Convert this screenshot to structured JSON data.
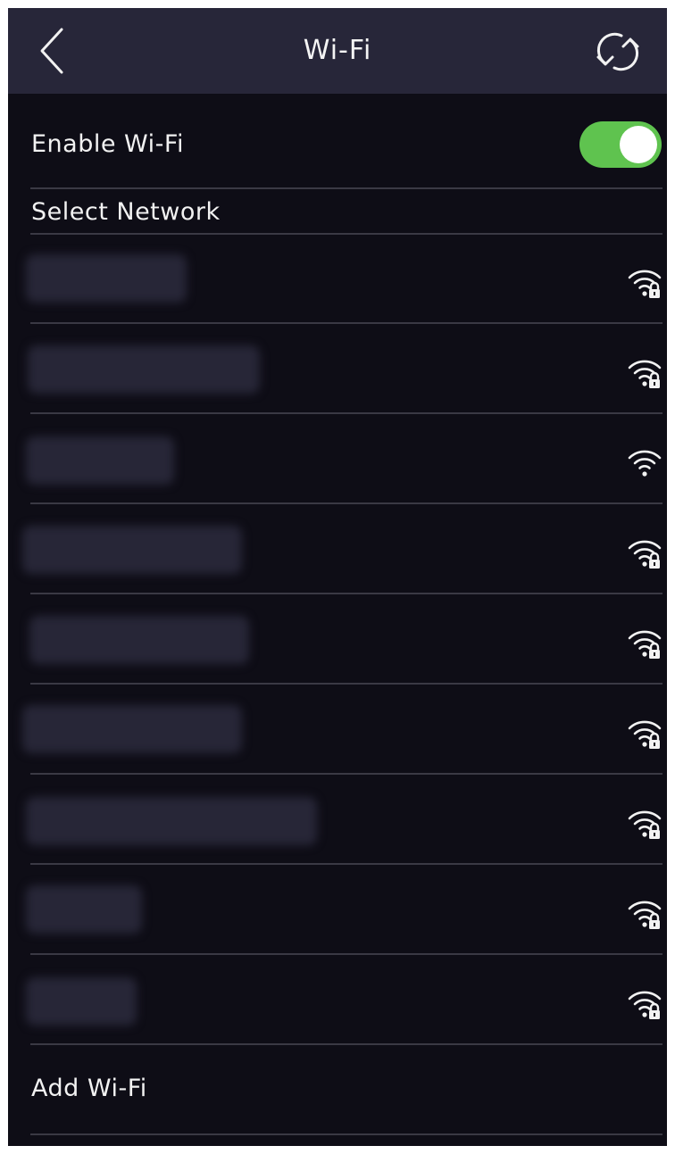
{
  "header": {
    "title": "Wi-Fi",
    "back_icon": "chevron-left-icon",
    "refresh_icon": "refresh-icon"
  },
  "enable_wifi": {
    "label": "Enable Wi-Fi",
    "enabled": true,
    "toggle_color": "#5fc34f"
  },
  "select_network": {
    "label": "Select Network"
  },
  "networks": [
    {
      "name": "",
      "obscured": true,
      "secured": true,
      "icon": "wifi-lock-icon"
    },
    {
      "name": "",
      "obscured": true,
      "secured": true,
      "icon": "wifi-lock-icon"
    },
    {
      "name": "",
      "obscured": true,
      "secured": false,
      "icon": "wifi-icon"
    },
    {
      "name": "",
      "obscured": true,
      "secured": true,
      "icon": "wifi-lock-icon"
    },
    {
      "name": "",
      "obscured": true,
      "secured": true,
      "icon": "wifi-lock-icon"
    },
    {
      "name": "",
      "obscured": true,
      "secured": true,
      "icon": "wifi-lock-icon"
    },
    {
      "name": "",
      "obscured": true,
      "secured": true,
      "icon": "wifi-lock-icon"
    },
    {
      "name": "",
      "obscured": true,
      "secured": true,
      "icon": "wifi-lock-icon"
    },
    {
      "name": "",
      "obscured": true,
      "secured": true,
      "icon": "wifi-lock-icon"
    }
  ],
  "add_wifi": {
    "label": "Add Wi-Fi"
  },
  "colors": {
    "background": "#0e0d16",
    "header": "#272639",
    "divider": "#3a3944",
    "text": "#f2f2f2"
  }
}
